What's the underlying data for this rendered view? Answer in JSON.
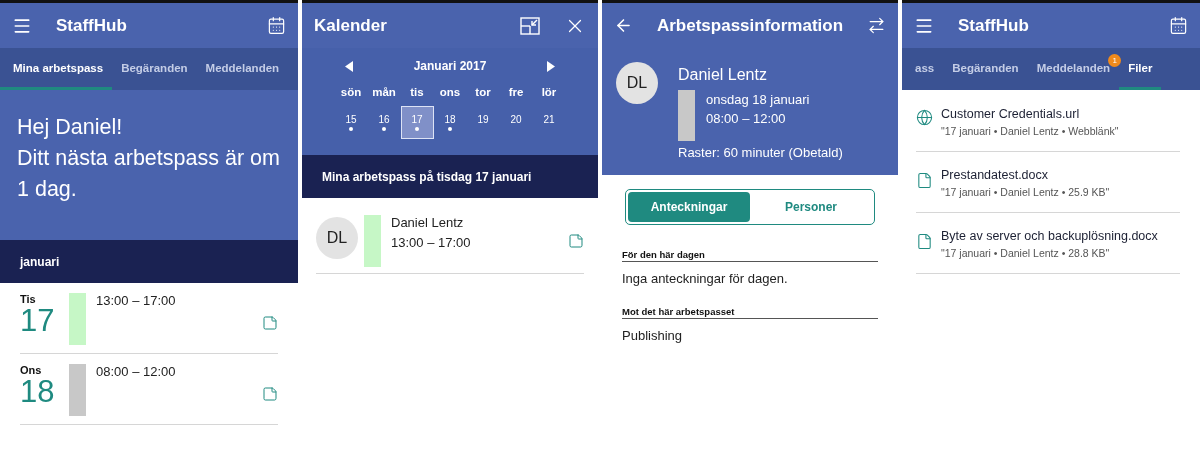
{
  "screens": [
    {
      "kind": "home",
      "title": "StaffHub",
      "tabs": [
        {
          "label": "Mina arbetspass",
          "selected": true
        },
        {
          "label": "Begäranden",
          "selected": false
        },
        {
          "label": "Meddelanden",
          "selected": false
        }
      ],
      "greeting": [
        "Hej Daniel!",
        "Ditt nästa arbetspass är om 1 dag."
      ],
      "month": "januari",
      "shifts": [
        {
          "weekday": "Tis",
          "day": "17",
          "time": "13:00 – 17:00",
          "color": "#c6f7c6"
        },
        {
          "weekday": "Ons",
          "day": "18",
          "time": "08:00 – 12:00",
          "color": "#c8c8c8"
        }
      ]
    },
    {
      "kind": "calendar",
      "title": "Kalender",
      "month": "Januari 2017",
      "weekdays": [
        "sön",
        "mån",
        "tis",
        "ons",
        "tor",
        "fre",
        "lör"
      ],
      "days": [
        {
          "label": "15",
          "dot": true,
          "selected": false
        },
        {
          "label": "16",
          "dot": true,
          "selected": false
        },
        {
          "label": "17",
          "dot": true,
          "selected": true
        },
        {
          "label": "18",
          "dot": true,
          "selected": false
        },
        {
          "label": "19",
          "dot": false,
          "selected": false
        },
        {
          "label": "20",
          "dot": false,
          "selected": false
        },
        {
          "label": "21",
          "dot": false,
          "selected": false
        }
      ],
      "section": "Mina arbetspass på tisdag 17 januari",
      "shifts": [
        {
          "initials": "DL",
          "name": "Daniel Lentz",
          "time": "13:00 – 17:00",
          "color": "#c6f7c6"
        }
      ]
    },
    {
      "kind": "details",
      "title": "Arbetspassinformation",
      "initials": "DL",
      "name": "Daniel Lentz",
      "date": "onsdag 18 januari",
      "time": "08:00 – 12:00",
      "color": "#c8c8c8",
      "break": "Raster: 60 minuter (Obetald)",
      "segments": [
        {
          "label": "Anteckningar",
          "selected": true
        },
        {
          "label": "Personer",
          "selected": false
        }
      ],
      "notes": [
        {
          "heading": "För den här dagen",
          "text": "Inga anteckningar för dagen."
        },
        {
          "heading": "Mot det här arbetspasset",
          "text": "Publishing"
        }
      ]
    },
    {
      "kind": "files",
      "title": "StaffHub",
      "tabs": [
        {
          "label": "ass",
          "selected": false
        },
        {
          "label": "Begäranden",
          "selected": false
        },
        {
          "label": "Meddelanden",
          "selected": false,
          "badge": "1"
        },
        {
          "label": "Filer",
          "selected": true
        }
      ],
      "files": [
        {
          "kind": "link",
          "name": "Customer Credentials.url",
          "meta": "\"17 januari • Daniel Lentz • Webblänk\""
        },
        {
          "kind": "document",
          "name": "Prestandatest.docx",
          "meta": "\"17 januari • Daniel Lentz • 25.9 KB\""
        },
        {
          "kind": "document",
          "name": "Byte av server och backuplösning.docx",
          "meta": "\"17 januari • Daniel Lentz • 28.8 KB\""
        }
      ]
    }
  ]
}
